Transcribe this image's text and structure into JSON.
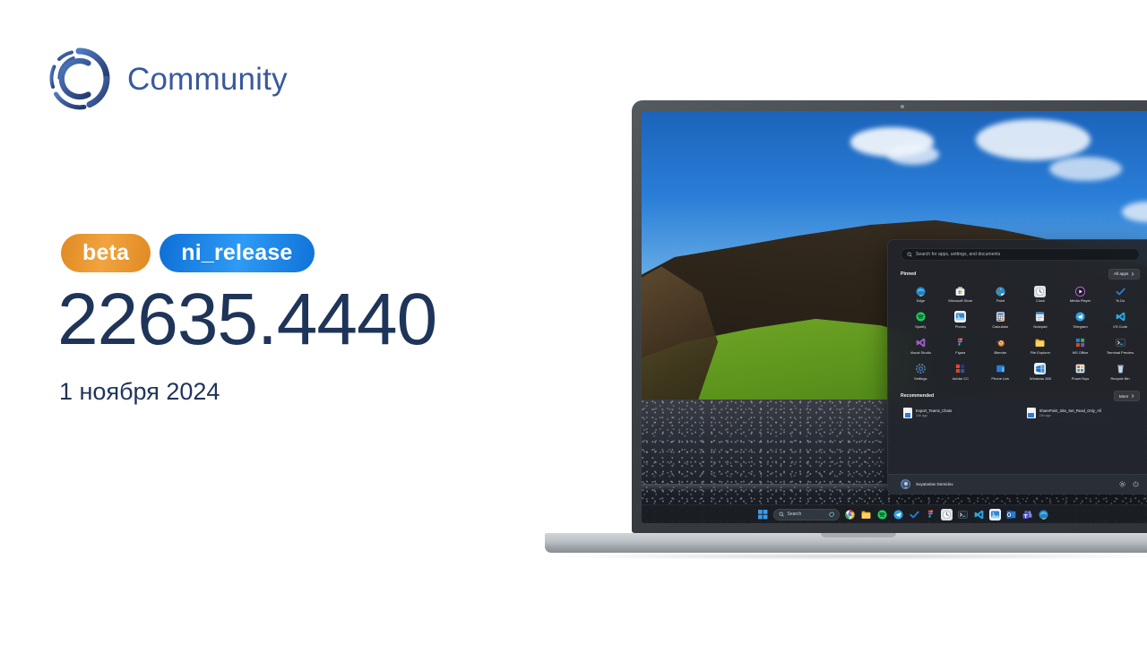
{
  "brand": {
    "name": "Community",
    "logo_icon": "community-circle-c-icon",
    "color": "#39599e"
  },
  "release": {
    "badges": [
      {
        "label": "beta",
        "color": "#e99a34",
        "name": "channel-badge-beta"
      },
      {
        "label": "ni_release",
        "color": "#1f8bef",
        "name": "branch-badge-ni-release"
      }
    ],
    "build_number": "22635.4440",
    "date": "1 ноября 2024",
    "text_color": "#1f3459"
  },
  "laptop": {
    "wallpaper_description": "Icelandic green moss cliff over black pebble beach",
    "camera_icon": "webcam-dot-icon"
  },
  "start_menu": {
    "search": {
      "placeholder": "Search for apps, settings, and documents",
      "icon": "search-icon"
    },
    "pinned": {
      "title": "Pinned",
      "all_apps_label": "All apps",
      "chevron_icon": "chevron-right-icon",
      "apps": [
        {
          "label": "Edge",
          "icon": "edge-icon"
        },
        {
          "label": "Microsoft Store",
          "icon": "microsoft-store-icon"
        },
        {
          "label": "Paint",
          "icon": "paint-icon"
        },
        {
          "label": "Clock",
          "icon": "clock-icon"
        },
        {
          "label": "Media Player",
          "icon": "media-player-icon"
        },
        {
          "label": "To Do",
          "icon": "todo-icon"
        },
        {
          "label": "Spotify",
          "icon": "spotify-icon"
        },
        {
          "label": "Photos",
          "icon": "photos-icon"
        },
        {
          "label": "Calculator",
          "icon": "calculator-icon"
        },
        {
          "label": "Notepad",
          "icon": "notepad-icon"
        },
        {
          "label": "Telegram",
          "icon": "telegram-icon"
        },
        {
          "label": "VS Code",
          "icon": "vscode-icon"
        },
        {
          "label": "Visual Studio",
          "icon": "visual-studio-icon"
        },
        {
          "label": "Figma",
          "icon": "figma-icon"
        },
        {
          "label": "Blender",
          "icon": "blender-icon"
        },
        {
          "label": "File Explorer",
          "icon": "file-explorer-icon"
        },
        {
          "label": "MS Office",
          "icon": "ms-office-icon"
        },
        {
          "label": "Terminal Preview",
          "icon": "terminal-preview-icon"
        },
        {
          "label": "Settings",
          "icon": "settings-gear-icon"
        },
        {
          "label": "Adobe CC",
          "icon": "adobe-cc-icon"
        },
        {
          "label": "Phone Link",
          "icon": "phone-link-icon"
        },
        {
          "label": "Windows 365",
          "icon": "windows-365-icon"
        },
        {
          "label": "PowerToys",
          "icon": "powertoys-icon"
        },
        {
          "label": "Recycle Bin",
          "icon": "recycle-bin-icon"
        }
      ]
    },
    "recommended": {
      "title": "Recommended",
      "more_label": "More",
      "chevron_icon": "chevron-right-icon",
      "items": [
        {
          "name": "Export_Teams_Chats",
          "time": "14h ago",
          "icon": "document-file-icon"
        },
        {
          "name": "SharePoint_Site_Set_Read_Only_All",
          "time": "15h ago",
          "icon": "document-file-icon"
        }
      ]
    },
    "footer": {
      "user_name": "Svyatoslav Demidov",
      "avatar_icon": "user-avatar-icon",
      "settings_icon": "settings-gear-icon",
      "power_icon": "power-icon"
    }
  },
  "taskbar": {
    "start_icon": "windows-start-icon",
    "search_label": "Search",
    "search_icon": "search-icon",
    "copilot_icon": "copilot-icon",
    "items": [
      {
        "icon": "chrome-icon"
      },
      {
        "icon": "file-explorer-icon"
      },
      {
        "icon": "spotify-icon"
      },
      {
        "icon": "telegram-icon"
      },
      {
        "icon": "todo-icon"
      },
      {
        "icon": "figma-icon"
      },
      {
        "icon": "clock-icon"
      },
      {
        "icon": "terminal-icon"
      },
      {
        "icon": "vscode-icon"
      },
      {
        "icon": "photos-icon"
      },
      {
        "icon": "outlook-icon"
      },
      {
        "icon": "teams-icon"
      },
      {
        "icon": "edge-icon"
      }
    ]
  }
}
